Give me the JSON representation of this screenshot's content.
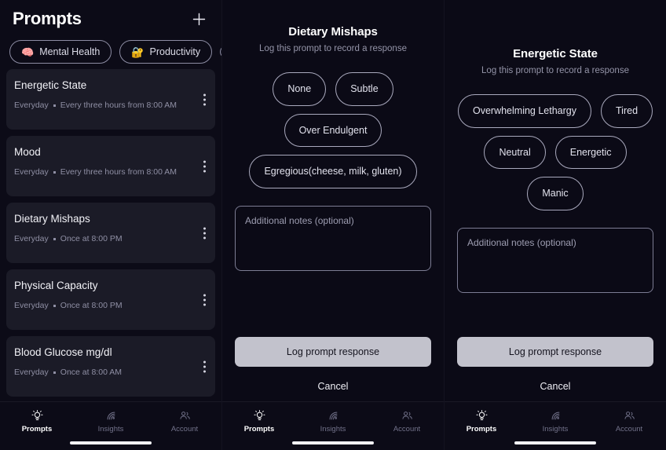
{
  "left_panel": {
    "title": "Prompts",
    "add_icon": "plus-icon",
    "chips": [
      {
        "emoji": "🧠",
        "label": "Mental Health"
      },
      {
        "emoji": "🔐",
        "label": "Productivity"
      },
      {
        "emoji": "",
        "label": ""
      }
    ],
    "prompts": [
      {
        "title": "Energetic State",
        "schedule_day": "Everyday",
        "schedule_time": "Every three hours from 8:00 AM"
      },
      {
        "title": "Mood",
        "schedule_day": "Everyday",
        "schedule_time": "Every three hours from 8:00 AM"
      },
      {
        "title": "Dietary Mishaps",
        "schedule_day": "Everyday",
        "schedule_time": "Once at 8:00 PM"
      },
      {
        "title": "Physical Capacity",
        "schedule_day": "Everyday",
        "schedule_time": "Once at 8:00 PM"
      },
      {
        "title": "Blood Glucose mg/dl",
        "schedule_day": "Everyday",
        "schedule_time": "Once at 8:00 AM"
      }
    ]
  },
  "middle_panel": {
    "title": "Dietary Mishaps",
    "subtitle": "Log this prompt to record a response",
    "options": [
      "None",
      "Subtle",
      "Over Endulgent",
      "Egregious(cheese, milk, gluten)"
    ],
    "notes_placeholder": "Additional notes (optional)",
    "notes_value": "",
    "submit_label": "Log prompt response",
    "cancel_label": "Cancel"
  },
  "right_panel": {
    "title": "Energetic State",
    "subtitle": "Log this prompt to record a response",
    "options": [
      "Overwhelming Lethargy",
      "Tired",
      "Neutral",
      "Energetic",
      "Manic"
    ],
    "notes_placeholder": "Additional notes (optional)",
    "notes_value": "",
    "submit_label": "Log prompt response",
    "cancel_label": "Cancel"
  },
  "bottom_nav": {
    "items": [
      {
        "label": "Prompts",
        "icon": "lightbulb-icon",
        "active": true
      },
      {
        "label": "Insights",
        "icon": "spiral-icon",
        "active": false
      },
      {
        "label": "Account",
        "icon": "people-icon",
        "active": false
      }
    ]
  },
  "colors": {
    "background": "#0c0b17",
    "card": "#1b1b27",
    "text_primary": "#ffffff",
    "text_muted": "#8f8fa4",
    "outline": "#a9a9bd",
    "submit_button": "#c2c2cc"
  }
}
